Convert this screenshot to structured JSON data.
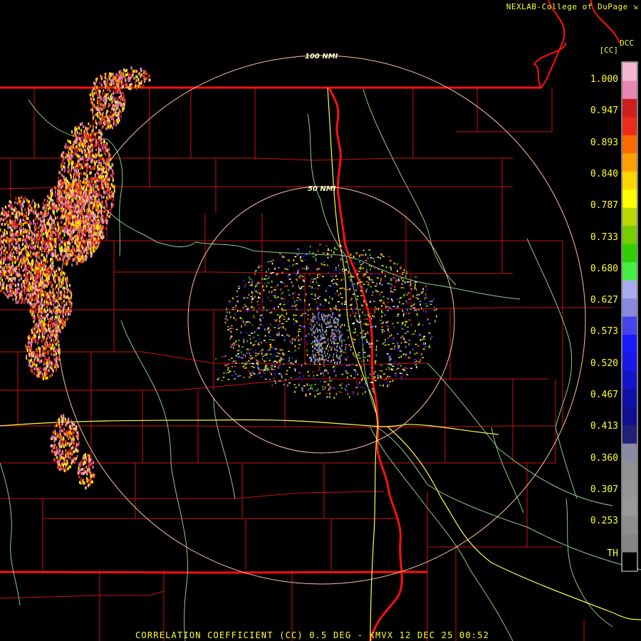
{
  "header": {
    "credit": "NEXLAB-College of DuPage"
  },
  "product": {
    "code": "DCC",
    "short": "[CC]"
  },
  "footer": {
    "caption": "CORRELATION COEFFICIENT (CC) 0.5 DEG - KMVX 12 DEC 25 00:52"
  },
  "rings": [
    {
      "label": "100 NMI",
      "range_nmi": 100
    },
    {
      "label": "50 NMI",
      "range_nmi": 50
    }
  ],
  "color_scale": {
    "labels": [
      "1.000",
      "0.947",
      "0.893",
      "0.840",
      "0.787",
      "0.733",
      "0.680",
      "0.627",
      "0.573",
      "0.520",
      "0.467",
      "0.413",
      "0.360",
      "0.307",
      "0.253",
      "TH"
    ],
    "colors": [
      "#f6b7d2",
      "#e886b4",
      "#cc2020",
      "#ee2a18",
      "#ff6a00",
      "#ffa000",
      "#ffd700",
      "#ffff00",
      "#b8d800",
      "#78cc00",
      "#30d000",
      "#44ee44",
      "#aaaaee",
      "#8888dd",
      "#4444ee",
      "#1a1aff",
      "#1818e8",
      "#1414c8",
      "#1010a8",
      "#101090",
      "#202078",
      "#8a8aa0",
      "#909090",
      "#959595",
      "#9a9a9a",
      "#8e8e8e",
      "#858585",
      "#000000"
    ]
  },
  "colors": {
    "state_border": "#ff1010",
    "county_line": "#cc1010",
    "highway": "#ffff44",
    "river": "#88cc88",
    "range_ring": "#ffc0a0",
    "text": "#ffff33"
  }
}
